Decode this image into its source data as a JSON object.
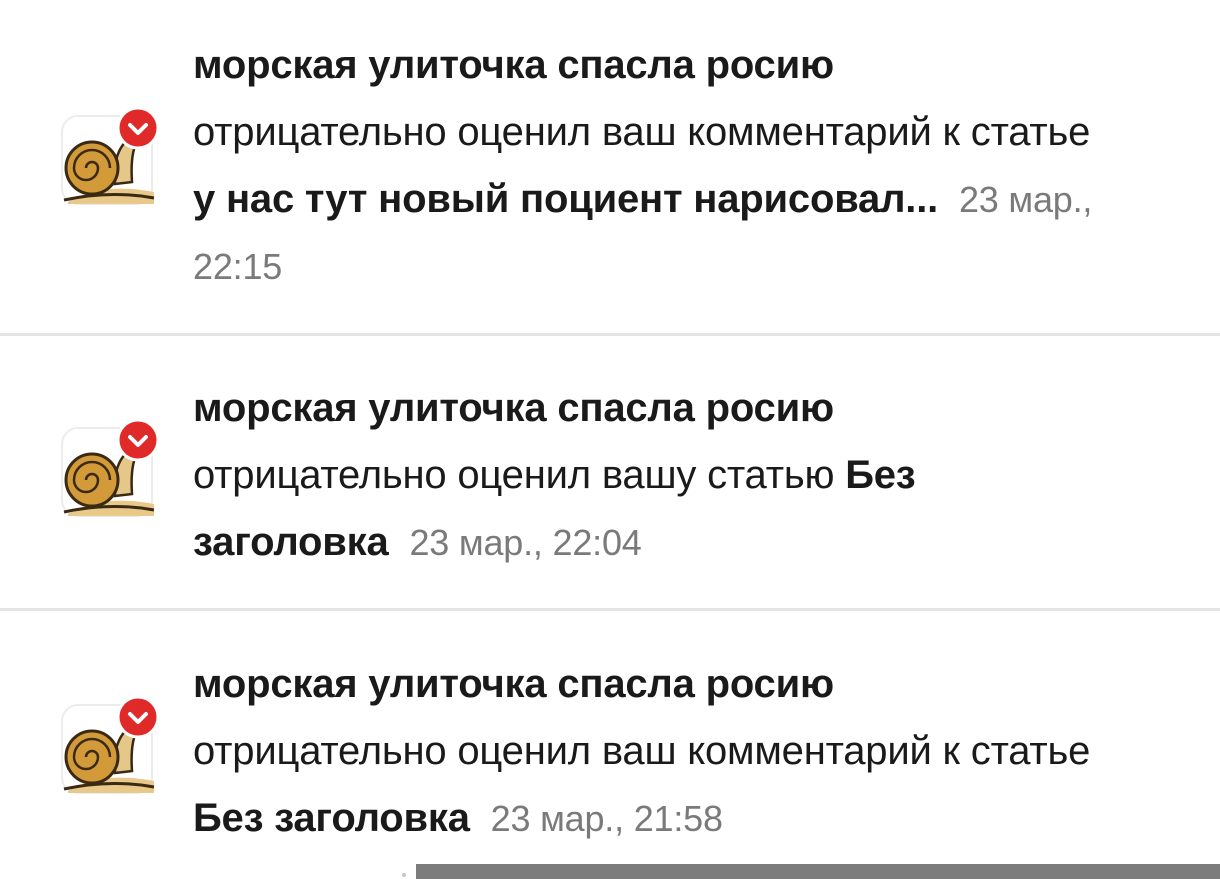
{
  "notifications": [
    {
      "author": "морская улиточка спасла росию",
      "action": "отрицательно оценил ваш комментарий к статье",
      "target": "у нас тут новый поциент нарисовал...",
      "time": "23 мар., 22:15"
    },
    {
      "author": "морская улиточка спасла росию",
      "action": "отрицательно оценил вашу статью",
      "target": "Без заголовка",
      "time": "23 мар., 22:04"
    },
    {
      "author": "морская улиточка спасла росию",
      "action": "отрицательно оценил ваш комментарий к статье",
      "target": "Без заголовка",
      "time": "23 мар., 21:58"
    }
  ],
  "colors": {
    "badge": "#e02a2a",
    "time": "#7a7a7a",
    "divider": "#e4e4e4"
  },
  "icons": {
    "avatar": "snail-avatar-icon",
    "badge": "chevron-down-badge-icon"
  }
}
